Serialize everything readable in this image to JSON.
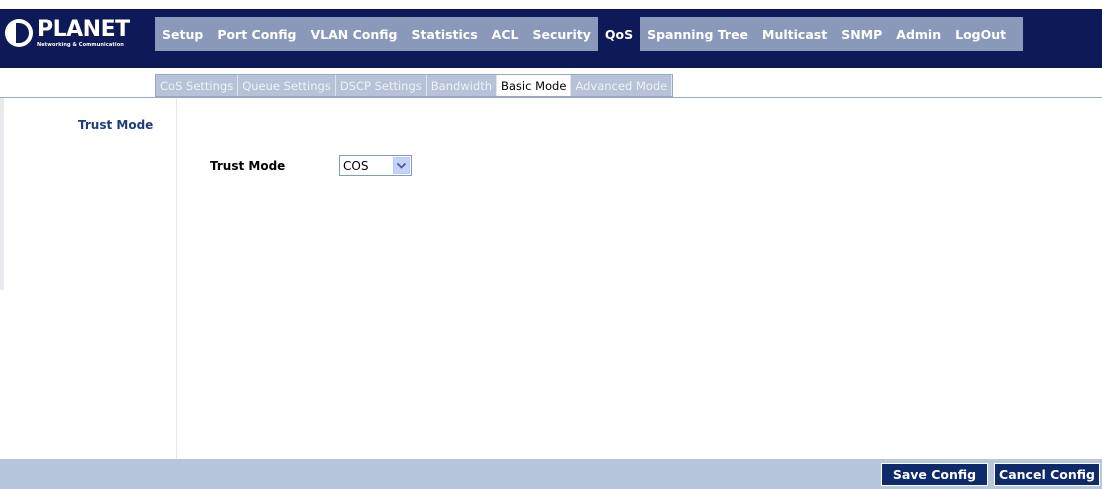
{
  "logo": {
    "name": "PLANET",
    "tagline": "Networking & Communication"
  },
  "main_nav": [
    {
      "label": "Setup",
      "active": false
    },
    {
      "label": "Port Config",
      "active": false
    },
    {
      "label": "VLAN Config",
      "active": false
    },
    {
      "label": "Statistics",
      "active": false
    },
    {
      "label": "ACL",
      "active": false
    },
    {
      "label": "Security",
      "active": false
    },
    {
      "label": "QoS",
      "active": true
    },
    {
      "label": "Spanning Tree",
      "active": false
    },
    {
      "label": "Multicast",
      "active": false
    },
    {
      "label": "SNMP",
      "active": false
    },
    {
      "label": "Admin",
      "active": false
    },
    {
      "label": "LogOut",
      "active": false
    }
  ],
  "sub_nav": [
    {
      "label": "CoS Settings",
      "active": false
    },
    {
      "label": "Queue Settings",
      "active": false
    },
    {
      "label": "DSCP Settings",
      "active": false
    },
    {
      "label": "Bandwidth",
      "active": false
    },
    {
      "label": "Basic Mode",
      "active": true
    },
    {
      "label": "Advanced Mode",
      "active": false
    }
  ],
  "sidebar": {
    "title": "Trust Mode"
  },
  "form": {
    "trust_mode": {
      "label": "Trust Mode",
      "selected": "COS"
    }
  },
  "footer": {
    "save_label": "Save Config",
    "cancel_label": "Cancel Config"
  },
  "colors": {
    "navy": "#0e1a57",
    "nav_bg": "#8a99b9",
    "subnav_bg": "#b7c2d8",
    "footer_bg": "#b7c6da",
    "button_bg": "#0e2a6b"
  }
}
